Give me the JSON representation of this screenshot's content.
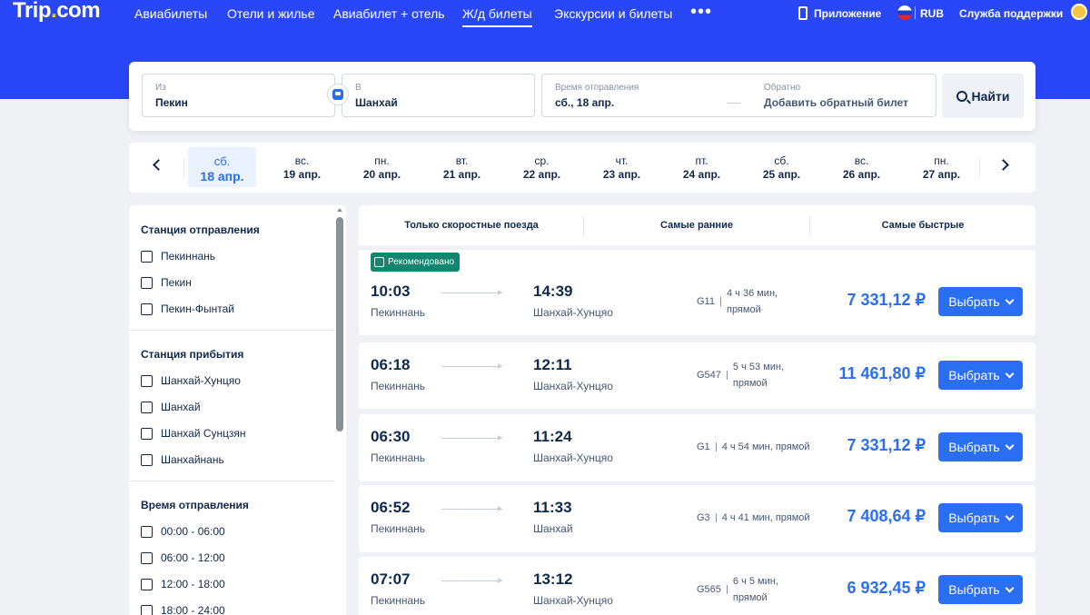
{
  "header": {
    "logo": "Trip.com",
    "nav": [
      "Авиабилеты",
      "Отели и жилье",
      "Авиабилет + отель",
      "Ж/д билеты",
      "Экскурсии и билеты"
    ],
    "more": "•••",
    "app": "Приложение",
    "currency": "RUB",
    "support": "Служба поддержки"
  },
  "search": {
    "from_label": "Из",
    "from_value": "Пекин",
    "to_label": "В",
    "to_value": "Шанхай",
    "depart_label": "Время отправления",
    "depart_value": "сб., 18 апр.",
    "return_label": "Обратно",
    "return_value": "Добавить обратный билет",
    "button": "Найти"
  },
  "dates": [
    {
      "wd": "сб.",
      "d": "18 апр.",
      "active": true
    },
    {
      "wd": "вс.",
      "d": "19 апр."
    },
    {
      "wd": "пн.",
      "d": "20 апр."
    },
    {
      "wd": "вт.",
      "d": "21 апр."
    },
    {
      "wd": "ср.",
      "d": "22 апр."
    },
    {
      "wd": "чт.",
      "d": "23 апр."
    },
    {
      "wd": "пт.",
      "d": "24 апр."
    },
    {
      "wd": "сб.",
      "d": "25 апр."
    },
    {
      "wd": "вс.",
      "d": "26 апр."
    },
    {
      "wd": "пн.",
      "d": "27 апр."
    }
  ],
  "filters": {
    "departure_title": "Станция отправления",
    "departure": [
      "Пекиннань",
      "Пекин",
      "Пекин-Фынтай"
    ],
    "arrival_title": "Станция прибытия",
    "arrival": [
      "Шанхай-Хунцяо",
      "Шанхай",
      "Шанхай Сунцзян",
      "Шанхайнань"
    ],
    "time_title": "Время отправления",
    "times": [
      "00:00 - 06:00",
      "06:00 - 12:00",
      "12:00 - 18:00",
      "18:00 - 24:00"
    ]
  },
  "sorts": [
    "Только скоростные поезда",
    "Самые ранние",
    "Самые быстрые"
  ],
  "badge": "Рекомендовано",
  "select_label": "Выбрать",
  "trains": [
    {
      "dep": "10:03",
      "arr": "14:39",
      "from": "Пекиннань",
      "to": "Шанхай-Хунцяо",
      "code": "G11",
      "dur1": "4 ч 36 мин,",
      "dur2": "прямой",
      "price": "7 331,12 ₽"
    },
    {
      "dep": "06:18",
      "arr": "12:11",
      "from": "Пекиннань",
      "to": "Шанхай-Хунцяо",
      "code": "G547",
      "dur1": "5 ч 53 мин,",
      "dur2": "прямой",
      "price": "11 461,80 ₽"
    },
    {
      "dep": "06:30",
      "arr": "11:24",
      "from": "Пекиннань",
      "to": "Шанхай-Хунцяо",
      "code": "G1",
      "dur1": "4 ч 54 мин, прямой",
      "dur2": "",
      "price": "7 331,12 ₽"
    },
    {
      "dep": "06:52",
      "arr": "11:33",
      "from": "Пекиннань",
      "to": "Шанхай",
      "code": "G3",
      "dur1": "4 ч 41 мин, прямой",
      "dur2": "",
      "price": "7 408,64 ₽"
    },
    {
      "dep": "07:07",
      "arr": "13:12",
      "from": "Пекиннань",
      "to": "Шанхай-Хунцяо",
      "code": "G565",
      "dur1": "6 ч 5 мин,",
      "dur2": "прямой",
      "price": "6 932,45 ₽"
    }
  ]
}
